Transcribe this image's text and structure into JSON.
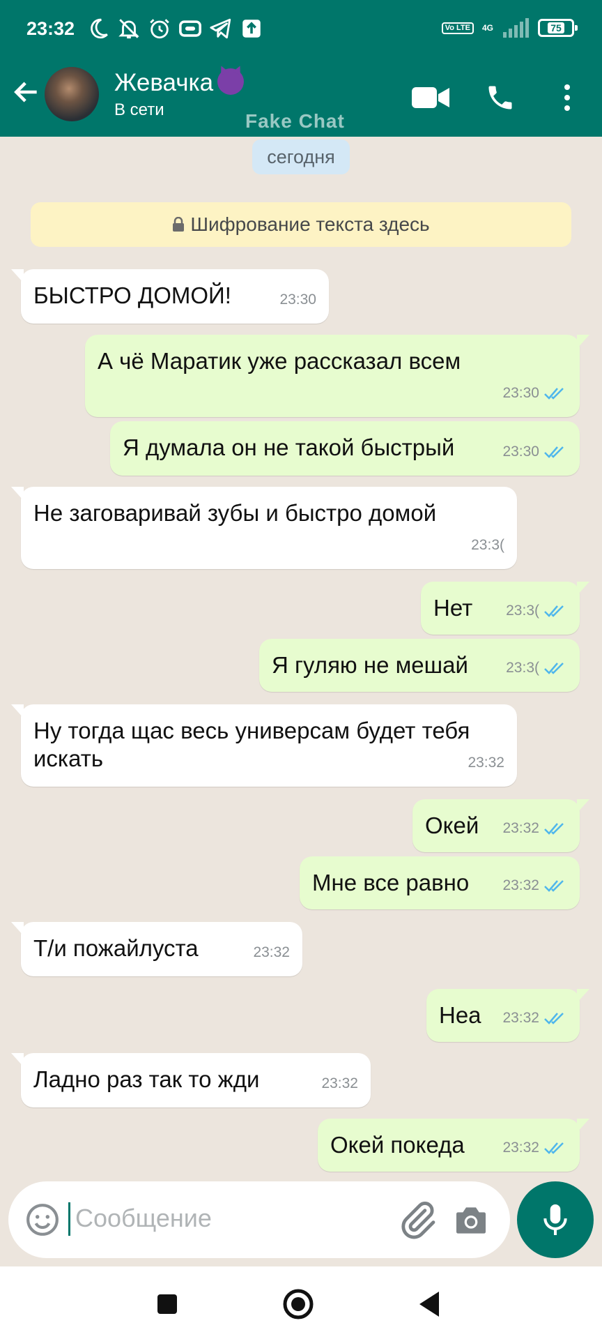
{
  "status_bar": {
    "time": "23:32",
    "volte_label": "Vo LTE",
    "network_label": "4G",
    "battery": "75"
  },
  "header": {
    "contact_name": "Жевачка",
    "contact_status": "В сети",
    "watermark": "Fake Chat"
  },
  "chat": {
    "date_chip": "сегодня",
    "encryption_notice": "Шифрование текста здесь",
    "messages": [
      {
        "dir": "in",
        "text": "БЫСТРО ДОМОЙ!",
        "time": "23:30"
      },
      {
        "dir": "out",
        "text": "А чё Маратик уже рассказал всем",
        "time": "23:30"
      },
      {
        "dir": "out",
        "text": "Я думала он не такой быстрый",
        "time": "23:30"
      },
      {
        "dir": "in",
        "text": "Не заговаривай зубы и быстро домой",
        "time": "23:3("
      },
      {
        "dir": "out",
        "text": "Нет",
        "time": "23:3("
      },
      {
        "dir": "out",
        "text": "Я гуляю не мешай",
        "time": "23:3("
      },
      {
        "dir": "in",
        "text": "Ну тогда щас весь универсам будет тебя искать",
        "time": "23:32"
      },
      {
        "dir": "out",
        "text": "Окей",
        "time": "23:32"
      },
      {
        "dir": "out",
        "text": "Мне все равно",
        "time": "23:32"
      },
      {
        "dir": "in",
        "text": "Т/и пожайлуста",
        "time": "23:32"
      },
      {
        "dir": "out",
        "text": "Неа",
        "time": "23:32"
      },
      {
        "dir": "in",
        "text": "Ладно раз так то жди",
        "time": "23:32"
      },
      {
        "dir": "out",
        "text": "Окей покеда",
        "time": "23:32"
      }
    ]
  },
  "input": {
    "placeholder": "Сообщение"
  },
  "colors": {
    "accent": "#00766a",
    "incoming_bubble": "#ffffff",
    "outgoing_bubble": "#e7fccf",
    "read_tick": "#4fb6ec",
    "chat_background": "#ece5dd"
  }
}
